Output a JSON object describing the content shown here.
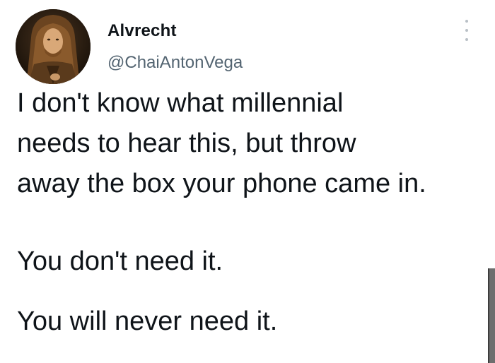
{
  "author": {
    "display_name": "Alvrecht",
    "handle": "@ChaiAntonVega",
    "avatar_icon": "portrait-avatar"
  },
  "more_menu": {
    "icon": "more-vertical-icon"
  },
  "tweet": {
    "lines": [
      "I don't know what millennial",
      "needs to hear this, but throw",
      "away the box your phone came in.",
      "You don't need it.",
      "You will never need it."
    ]
  },
  "colors": {
    "text": "#0f1419",
    "handle": "#536471",
    "background": "#ffffff"
  }
}
